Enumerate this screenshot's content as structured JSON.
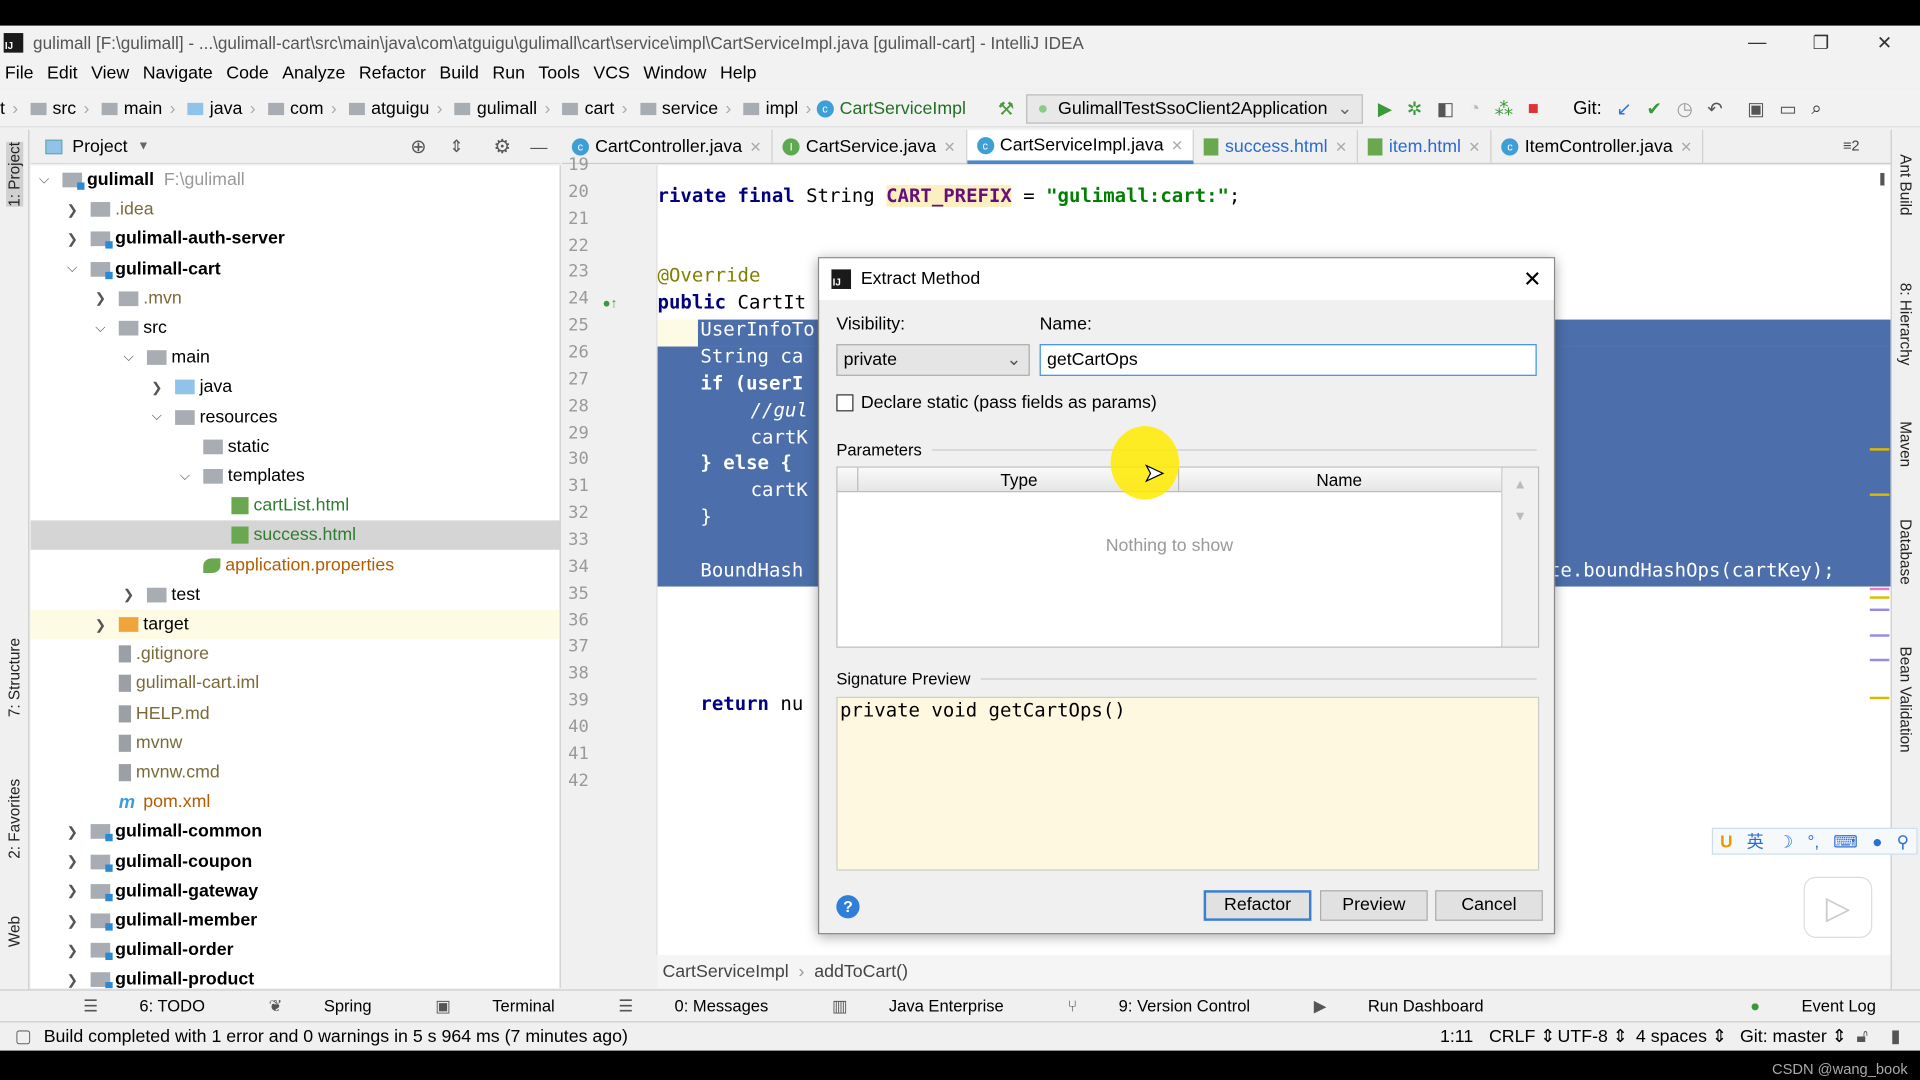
{
  "window": {
    "title": "gulimall [F:\\gulimall] - ...\\gulimall-cart\\src\\main\\java\\com\\atguigu\\gulimall\\cart\\service\\impl\\CartServiceImpl.java [gulimall-cart] - IntelliJ IDEA",
    "logo": "IJ"
  },
  "menu": [
    "File",
    "Edit",
    "View",
    "Navigate",
    "Code",
    "Analyze",
    "Refactor",
    "Build",
    "Run",
    "Tools",
    "VCS",
    "Window",
    "Help"
  ],
  "breadcrumb": [
    "t",
    "src",
    "main",
    "java",
    "com",
    "atguigu",
    "gulimall",
    "cart",
    "service",
    "impl"
  ],
  "breadcrumb_class": "CartServiceImpl",
  "run_config": "GulimallTestSsoClient2Application",
  "git_label": "Git:",
  "project_panel": {
    "title": "Project"
  },
  "left_tools": [
    "1: Project",
    "7: Structure",
    "2: Favorites",
    "Web"
  ],
  "right_tools": [
    "Ant Build",
    "8: Hierarchy",
    "Maven",
    "Database",
    "Bean Validation"
  ],
  "tree": [
    {
      "label": "gulimall",
      "hint": "F:\\gulimall",
      "depth": 0,
      "open": true,
      "bold": true,
      "icon": "module"
    },
    {
      "label": ".idea",
      "depth": 1,
      "open": false,
      "icon": "folder",
      "color": "#7a6a3a"
    },
    {
      "label": "gulimall-auth-server",
      "depth": 1,
      "open": false,
      "bold": true,
      "icon": "module"
    },
    {
      "label": "gulimall-cart",
      "depth": 1,
      "open": true,
      "bold": true,
      "icon": "module"
    },
    {
      "label": ".mvn",
      "depth": 2,
      "open": false,
      "icon": "folder",
      "color": "#7a6a3a"
    },
    {
      "label": "src",
      "depth": 2,
      "open": true,
      "icon": "folder"
    },
    {
      "label": "main",
      "depth": 3,
      "open": true,
      "icon": "folder"
    },
    {
      "label": "java",
      "depth": 4,
      "open": false,
      "icon": "java"
    },
    {
      "label": "resources",
      "depth": 4,
      "open": true,
      "icon": "folder"
    },
    {
      "label": "static",
      "depth": 5,
      "icon": "folder"
    },
    {
      "label": "templates",
      "depth": 5,
      "open": true,
      "icon": "folder"
    },
    {
      "label": "cartList.html",
      "depth": 6,
      "icon": "html",
      "color": "#2e7d32"
    },
    {
      "label": "success.html",
      "depth": 6,
      "icon": "html",
      "color": "#2e7d32",
      "selected": true
    },
    {
      "label": "application.properties",
      "depth": 5,
      "icon": "spring",
      "color": "#b35c00"
    },
    {
      "label": "test",
      "depth": 3,
      "open": false,
      "icon": "folder"
    },
    {
      "label": "target",
      "depth": 2,
      "open": false,
      "icon": "orange",
      "highlight": true
    },
    {
      "label": ".gitignore",
      "depth": 2,
      "icon": "file",
      "color": "#7a6a3a"
    },
    {
      "label": "gulimall-cart.iml",
      "depth": 2,
      "icon": "file",
      "color": "#7a6a3a"
    },
    {
      "label": "HELP.md",
      "depth": 2,
      "icon": "file",
      "color": "#7a6a3a"
    },
    {
      "label": "mvnw",
      "depth": 2,
      "icon": "file",
      "color": "#7a6a3a"
    },
    {
      "label": "mvnw.cmd",
      "depth": 2,
      "icon": "file",
      "color": "#7a6a3a"
    },
    {
      "label": "pom.xml",
      "depth": 2,
      "icon": "m",
      "color": "#b35c00"
    },
    {
      "label": "gulimall-common",
      "depth": 1,
      "open": false,
      "bold": true,
      "icon": "module"
    },
    {
      "label": "gulimall-coupon",
      "depth": 1,
      "open": false,
      "bold": true,
      "icon": "module"
    },
    {
      "label": "gulimall-gateway",
      "depth": 1,
      "open": false,
      "bold": true,
      "icon": "module"
    },
    {
      "label": "gulimall-member",
      "depth": 1,
      "open": false,
      "bold": true,
      "icon": "module"
    },
    {
      "label": "gulimall-order",
      "depth": 1,
      "open": false,
      "bold": true,
      "icon": "module"
    },
    {
      "label": "gulimall-product",
      "depth": 1,
      "open": false,
      "bold": true,
      "icon": "module"
    }
  ],
  "tabs": [
    {
      "label": "CartController.java",
      "icon": "class"
    },
    {
      "label": "CartService.java",
      "icon": "interface"
    },
    {
      "label": "CartServiceImpl.java",
      "icon": "class",
      "active": true
    },
    {
      "label": "success.html",
      "icon": "html"
    },
    {
      "label": "item.html",
      "icon": "html"
    },
    {
      "label": "ItemController.java",
      "icon": "class"
    }
  ],
  "tabs_overflow": "≡2",
  "line_numbers": [
    "19",
    "20",
    "21",
    "22",
    "23",
    "24",
    "25",
    "26",
    "27",
    "28",
    "29",
    "30",
    "31",
    "32",
    "33",
    "34",
    "35",
    "36",
    "37",
    "38",
    "39",
    "40",
    "41",
    "42"
  ],
  "code": {
    "l20": [
      [
        "rivate final ",
        "kw"
      ],
      [
        "String ",
        ""
      ],
      [
        "CART_PREFIX",
        "const"
      ],
      [
        " = ",
        ""
      ],
      [
        "\"gulimall:cart:\"",
        "str"
      ],
      [
        ";",
        ""
      ]
    ],
    "l23": [
      [
        "@Override",
        "ann"
      ]
    ],
    "l24": [
      [
        "public ",
        "kw"
      ],
      [
        "CartIt",
        ""
      ]
    ],
    "l25": "UserInfoTo",
    "l26": "String ca",
    "l27": "if (userI",
    "l28": "//gul",
    "l29": "cartK",
    "l30": "} else {",
    "l31": "cartK",
    "l32": "}",
    "l34": "BoundHash",
    "l34_tail": "te.boundHashOps(cartKey);",
    "l39": [
      [
        "return ",
        "kw"
      ],
      [
        "nu",
        ""
      ]
    ]
  },
  "editor_breadcrumb": [
    "CartServiceImpl",
    "addToCart()"
  ],
  "dialog": {
    "title": "Extract Method",
    "visibility_label": "Visibility:",
    "visibility_value": "private",
    "name_label": "Name:",
    "name_value": "getCartOps",
    "declare_static_label": "Declare static (pass fields as params)",
    "declare_static_checked": false,
    "parameters_label": "Parameters",
    "columns": [
      "Type",
      "Name"
    ],
    "empty_text": "Nothing to show",
    "signature_label": "Signature Preview",
    "signature": "private void getCartOps()",
    "buttons": {
      "refactor": "Refactor",
      "preview": "Preview",
      "cancel": "Cancel"
    }
  },
  "tool_windows": [
    "6: TODO",
    "Spring",
    "Terminal",
    "0: Messages",
    "Java Enterprise",
    "9: Version Control",
    "Run Dashboard"
  ],
  "event_log": "Event Log",
  "status": {
    "message": "Build completed with 1 error and 0 warnings in 5 s 964 ms (7 minutes ago)",
    "position": "1:11",
    "line_sep": "CRLF",
    "encoding": "UTF-8",
    "indent": "4 spaces",
    "git": "Git: master"
  },
  "ime": [
    "英",
    "☽",
    "°,",
    "⌨",
    "👤",
    "🔧"
  ],
  "watermark": "CSDN @wang_book",
  "colors": {
    "selection": "#4c6fab",
    "accent": "#3c7fd0",
    "signature_bg": "#fef8e1"
  }
}
